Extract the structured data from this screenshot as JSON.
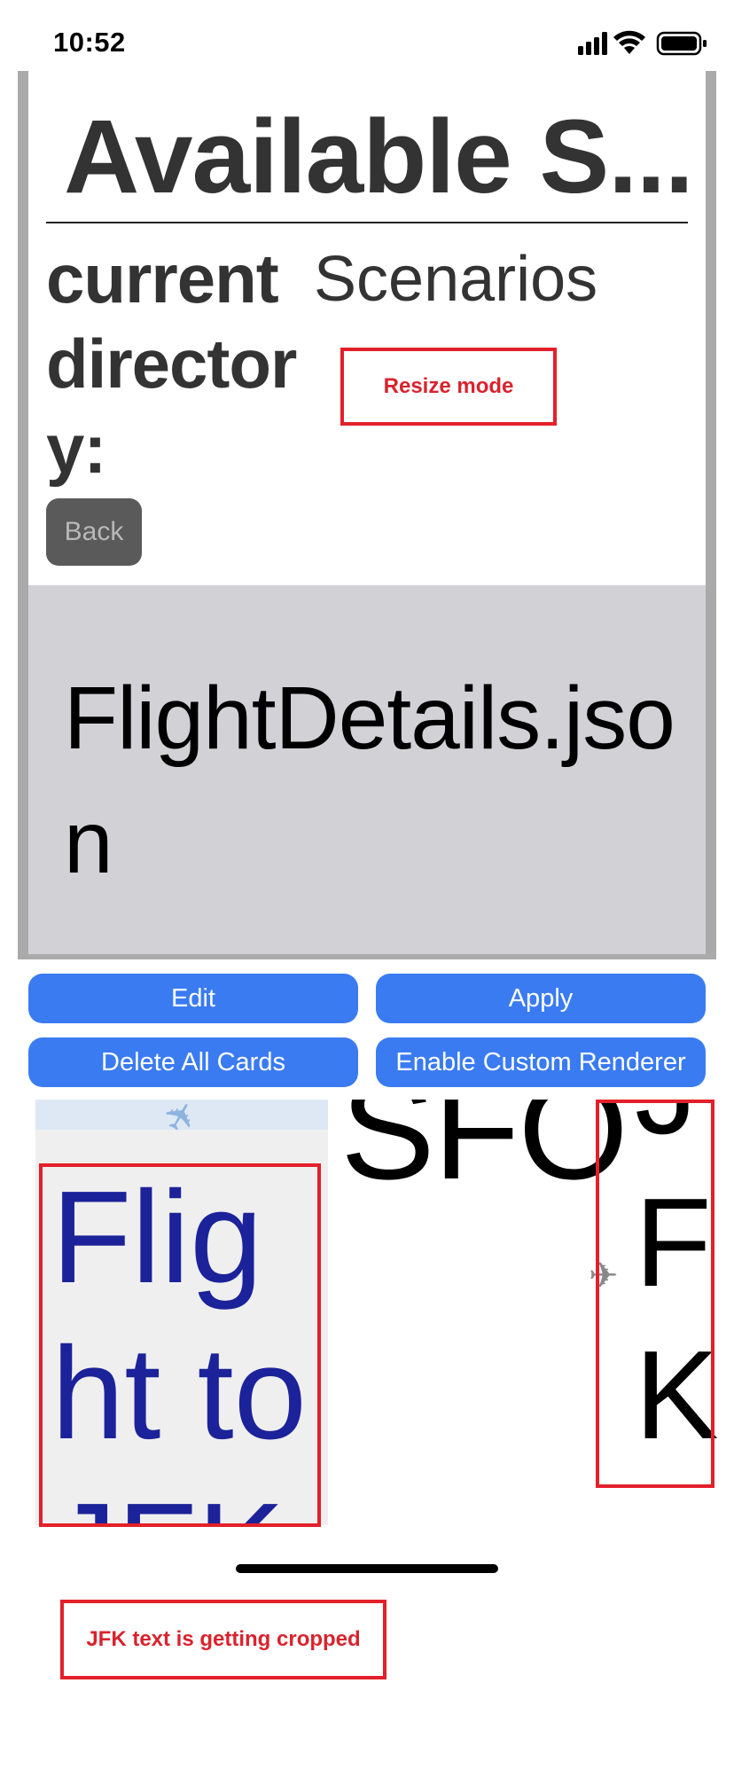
{
  "status_bar": {
    "time": "10:52",
    "icons": [
      "cellular-signal-icon",
      "wifi-icon",
      "battery-icon"
    ]
  },
  "header": {
    "title": "Available S...",
    "directory_label": "current director y:",
    "directory_value": "Scenarios"
  },
  "back_button": {
    "label": "Back"
  },
  "file_card": {
    "name": "FlightDetails.json"
  },
  "actions": {
    "edit": "Edit",
    "apply": "Apply",
    "delete_all": "Delete All Cards",
    "enable_renderer": "Enable Custom Renderer"
  },
  "preview": {
    "card_title": "Flight to JFK",
    "origin_code": "SFO",
    "destination_code": "JFK"
  },
  "annotations": {
    "resize_mode": "Resize mode",
    "cropped_note": "JFK text is getting cropped"
  },
  "colors": {
    "button_blue": "#3a7bf2",
    "annotation_red": "#e3202a",
    "card_grey": "#d1d1d6",
    "card_title_blue": "#1c2299"
  }
}
